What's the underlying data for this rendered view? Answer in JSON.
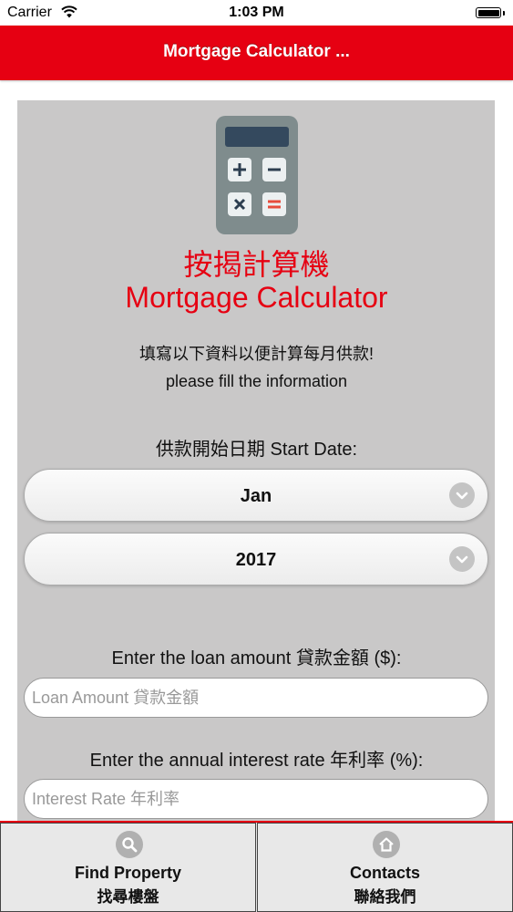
{
  "status_bar": {
    "carrier": "Carrier",
    "time": "1:03 PM"
  },
  "header": {
    "title": "Mortgage Calculator ...",
    "bg_color": "#e60012"
  },
  "hero": {
    "icon": "calculator-icon",
    "title_cn": "按揭計算機",
    "title_en": "Mortgage Calculator",
    "accent_color": "#e60012"
  },
  "instructions": {
    "cn": "填寫以下資料以便計算每月供款!",
    "en": "please fill the information"
  },
  "form": {
    "start_date_label": "供款開始日期 Start Date:",
    "month_value": "Jan",
    "year_value": "2017",
    "loan_label": "Enter the loan amount 貸款金額 ($):",
    "loan_placeholder": "Loan Amount 貸款金額",
    "rate_label": "Enter the annual interest rate 年利率 (%):",
    "rate_placeholder": "Interest Rate 年利率"
  },
  "bottom_nav": {
    "items": [
      {
        "label_en": "Find Property",
        "label_cn": "找尋樓盤",
        "icon": "search-icon"
      },
      {
        "label_en": "Contacts",
        "label_cn": "聯絡我們",
        "icon": "home-icon"
      }
    ]
  }
}
